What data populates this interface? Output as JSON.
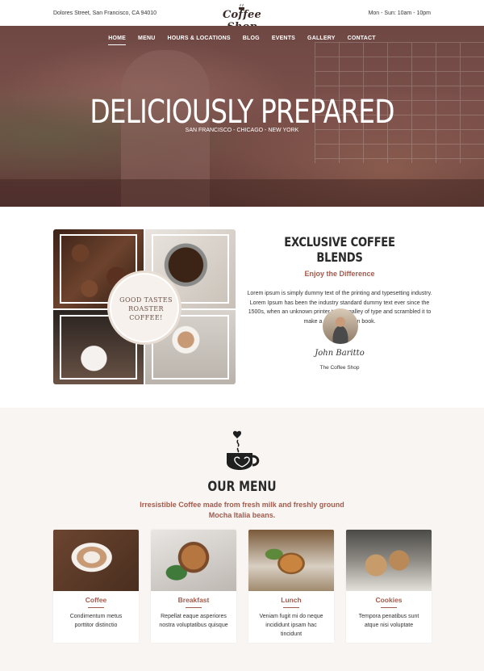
{
  "topbar": {
    "address": "Dolores Street, San Francisco, CA 94010",
    "logo": "Coffee Shop",
    "hours": "Mon - Sun: 10am - 10pm"
  },
  "nav": {
    "items": [
      "HOME",
      "MENU",
      "HOURS & LOCATIONS",
      "BLOG",
      "EVENTS",
      "GALLERY",
      "CONTACT"
    ],
    "active": "HOME"
  },
  "hero": {
    "title": "DELICIOUSLY PREPARED",
    "subtitle": "SAN FRANCISCO - CHICAGO - NEW YORK"
  },
  "blends": {
    "badge_line1": "GOOD TASTES",
    "badge_line2": "ROASTER",
    "badge_line3": "COFFEE!",
    "title": "EXCLUSIVE COFFEE BLENDS",
    "tagline": "Enjoy the Difference",
    "body": "Lorem ipsum is simply dummy text of the printing and typesetting industry. Lorem Ipsum has been the industry standard dummy text ever since the 1500s, when an unknown printer took a galley of type and scrambled it to make a type specimen book.",
    "signature": "John Baritto",
    "signature_caption": "The Coffee Shop"
  },
  "menu": {
    "title": "OUR MENU",
    "intro": "Irresistible Coffee made from fresh milk and freshly ground Mocha Italia beans.",
    "cards": [
      {
        "title": "Coffee",
        "desc": "Condimentum metus porttitor distinctio"
      },
      {
        "title": "Breakfast",
        "desc": "Repellat eaque asperiores nostra voluptatibus quisque"
      },
      {
        "title": "Lunch",
        "desc": "Veniam fugit mi do neque incididunt ipsam hac tincidunt"
      },
      {
        "title": "Cookies",
        "desc": "Tempora penatibus sunt atque nisi voluptate"
      }
    ]
  },
  "colors": {
    "accent": "#a15b4d",
    "hero_overlay": "#6e4743",
    "menu_background": "#f9f5f3",
    "heading": "#2a2a2a"
  },
  "icons": [
    "coffee-cup-logo-icon",
    "coffee-cup-heart-icon"
  ]
}
